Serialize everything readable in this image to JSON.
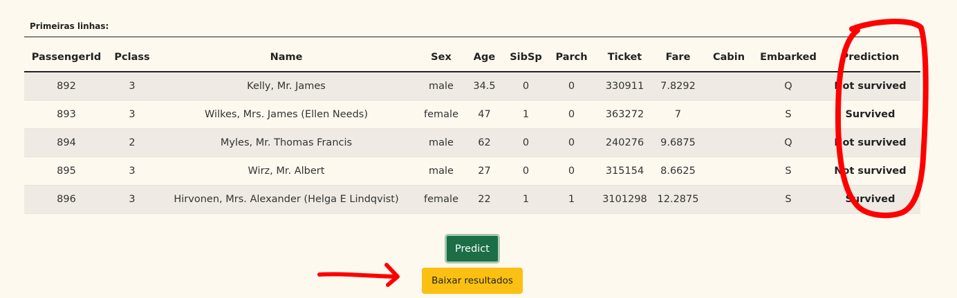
{
  "caption": "Primeiras linhas:",
  "table": {
    "headers": [
      "PassengerId",
      "Pclass",
      "Name",
      "Sex",
      "Age",
      "SibSp",
      "Parch",
      "Ticket",
      "Fare",
      "Cabin",
      "Embarked",
      "Prediction"
    ],
    "rows": [
      [
        "892",
        "3",
        "Kelly, Mr. James",
        "male",
        "34.5",
        "0",
        "0",
        "330911",
        "7.8292",
        "",
        "Q",
        "Not survived"
      ],
      [
        "893",
        "3",
        "Wilkes, Mrs. James (Ellen Needs)",
        "female",
        "47",
        "1",
        "0",
        "363272",
        "7",
        "",
        "S",
        "Survived"
      ],
      [
        "894",
        "2",
        "Myles, Mr. Thomas Francis",
        "male",
        "62",
        "0",
        "0",
        "240276",
        "9.6875",
        "",
        "Q",
        "Not survived"
      ],
      [
        "895",
        "3",
        "Wirz, Mr. Albert",
        "male",
        "27",
        "0",
        "0",
        "315154",
        "8.6625",
        "",
        "S",
        "Not survived"
      ],
      [
        "896",
        "3",
        "Hirvonen, Mrs. Alexander (Helga E Lindqvist)",
        "female",
        "22",
        "1",
        "1",
        "3101298",
        "12.2875",
        "",
        "S",
        "Survived"
      ]
    ]
  },
  "buttons": {
    "predict_label": "Predict",
    "download_label": "Baixar resultados"
  },
  "colors": {
    "background": "#fdf9ef",
    "striped_row": "#efebe4",
    "predict_button": "#1c6e47",
    "download_button": "#fbc012",
    "annotation": "#ff0000"
  },
  "annotations": [
    "red-circle-around-prediction-column",
    "red-arrow-pointing-to-download-button"
  ]
}
